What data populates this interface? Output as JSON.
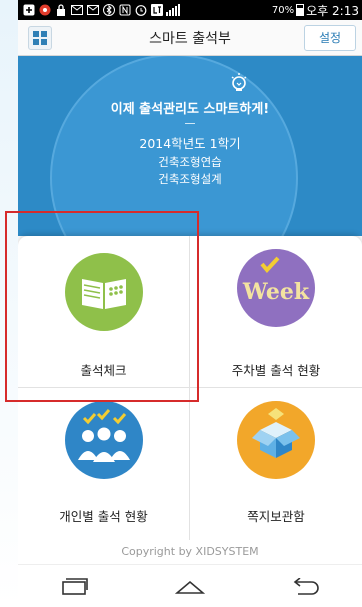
{
  "status_bar": {
    "battery_level": "70%",
    "time": "오후 2:13",
    "icons": [
      "add-icon",
      "notification-icon",
      "lock-icon",
      "mail-icon",
      "mail-icon",
      "bluetooth-icon",
      "nfc-icon",
      "alarm-icon",
      "lte-icon",
      "signal-icon",
      "battery-icon"
    ]
  },
  "header": {
    "menu_icon": "grid-menu-icon",
    "title": "스마트 출석부",
    "settings_label": "설정"
  },
  "banner": {
    "icon": "lightbulb-icon",
    "slogan": "이제 출석관리도 스마트하게!",
    "term": "2014학년도 1학기",
    "courses": [
      "건축조형연습",
      "건축조형설계"
    ]
  },
  "menu": {
    "attendance_check": {
      "label": "출석체크",
      "icon": "book-icon",
      "color": "#8fc04a"
    },
    "weekly_status": {
      "label": "주차별 출석 현황",
      "icon": "week-icon",
      "color": "#8f70c0"
    },
    "individual_status": {
      "label": "개인별 출석 현황",
      "icon": "people-icon",
      "color": "#2f86c7"
    },
    "message_box": {
      "label": "쪽지보관함",
      "icon": "open-box-icon",
      "color": "#f2a72a"
    }
  },
  "footer": {
    "copyright": "Copyright by XIDSYSTEM"
  },
  "navigation": {
    "recent_icon": "recent-apps-icon",
    "home_icon": "home-icon",
    "back_icon": "back-icon"
  },
  "colors": {
    "banner_blue": "#2d8ac6",
    "accent": "#2a7cb5",
    "highlight_red": "#d62b2b"
  }
}
